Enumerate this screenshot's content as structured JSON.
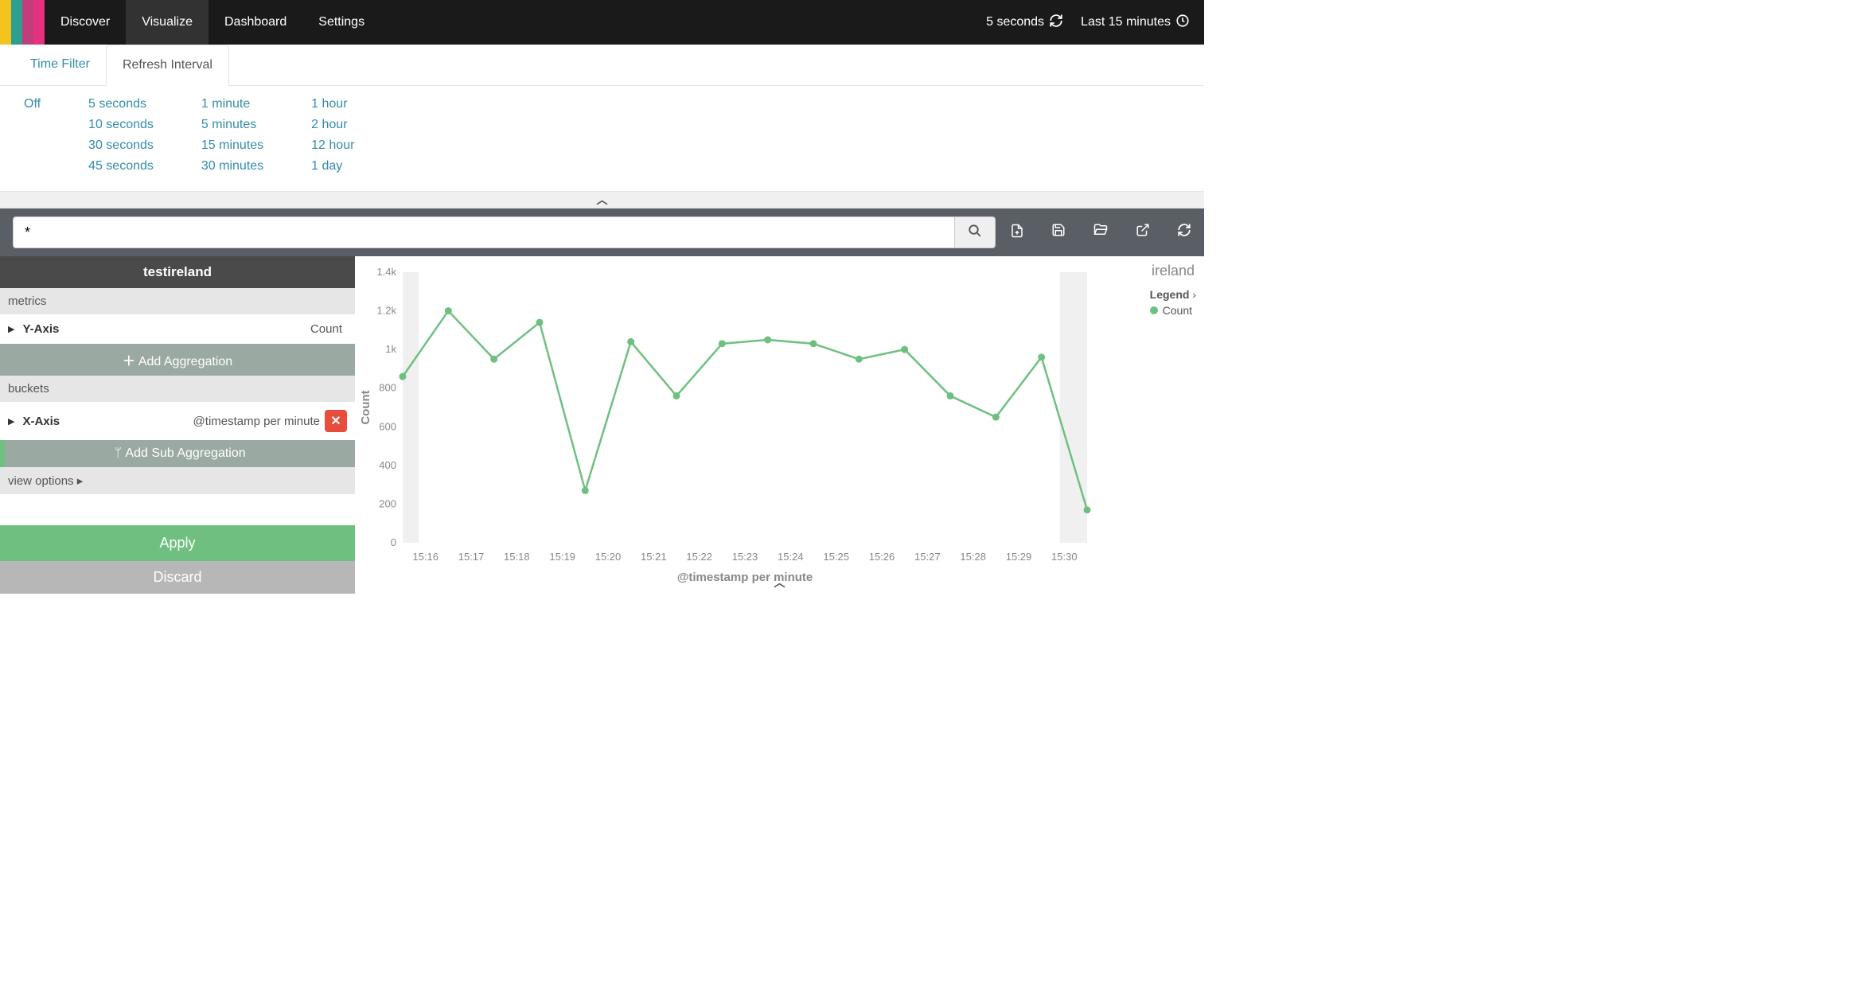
{
  "nav": {
    "items": [
      "Discover",
      "Visualize",
      "Dashboard",
      "Settings"
    ],
    "active": 1,
    "refresh_label": "5 seconds",
    "timerange_label": "Last 15 minutes",
    "logo_colors": [
      "#f3c51c",
      "#2e9e8f",
      "#c13d7b",
      "#e6317f"
    ]
  },
  "subtabs": {
    "items": [
      "Time Filter",
      "Refresh Interval"
    ],
    "active": 1
  },
  "refresh_interval": {
    "cols": [
      [
        "Off"
      ],
      [
        "5 seconds",
        "10 seconds",
        "30 seconds",
        "45 seconds"
      ],
      [
        "1 minute",
        "5 minutes",
        "15 minutes",
        "30 minutes"
      ],
      [
        "1 hour",
        "2 hour",
        "12 hour",
        "1 day"
      ]
    ]
  },
  "search": {
    "query": "*"
  },
  "sidebar": {
    "title": "testireland",
    "metrics_label": "metrics",
    "yaxis_label": "Y-Axis",
    "yaxis_value": "Count",
    "add_aggregation": "Add Aggregation",
    "buckets_label": "buckets",
    "xaxis_label": "X-Axis",
    "xaxis_value": "@timestamp per minute",
    "add_sub": "Add Sub Aggregation",
    "view_options": "view options",
    "apply": "Apply",
    "discard": "Discard"
  },
  "panel": {
    "name": "ireland",
    "legend_title": "Legend",
    "legend_series": "Count"
  },
  "chart_data": {
    "type": "line",
    "title": "",
    "xlabel": "@timestamp per minute",
    "ylabel": "Count",
    "ylim": [
      0,
      1400
    ],
    "yticks": [
      0,
      200,
      400,
      600,
      800,
      1000,
      1200,
      1400
    ],
    "ytick_labels": [
      "0",
      "200",
      "400",
      "600",
      "800",
      "1k",
      "1.2k",
      "1.4k"
    ],
    "categories": [
      "15:16",
      "15:17",
      "15:18",
      "15:19",
      "15:20",
      "15:21",
      "15:22",
      "15:23",
      "15:24",
      "15:25",
      "15:26",
      "15:27",
      "15:28",
      "15:29",
      "15:30"
    ],
    "series": [
      {
        "name": "Count",
        "color": "#6fc080",
        "values": [
          860,
          1200,
          950,
          1140,
          270,
          1040,
          760,
          1030,
          1050,
          1030,
          950,
          1000,
          760,
          650,
          960,
          170
        ],
        "x_offset": -0.5
      }
    ]
  }
}
